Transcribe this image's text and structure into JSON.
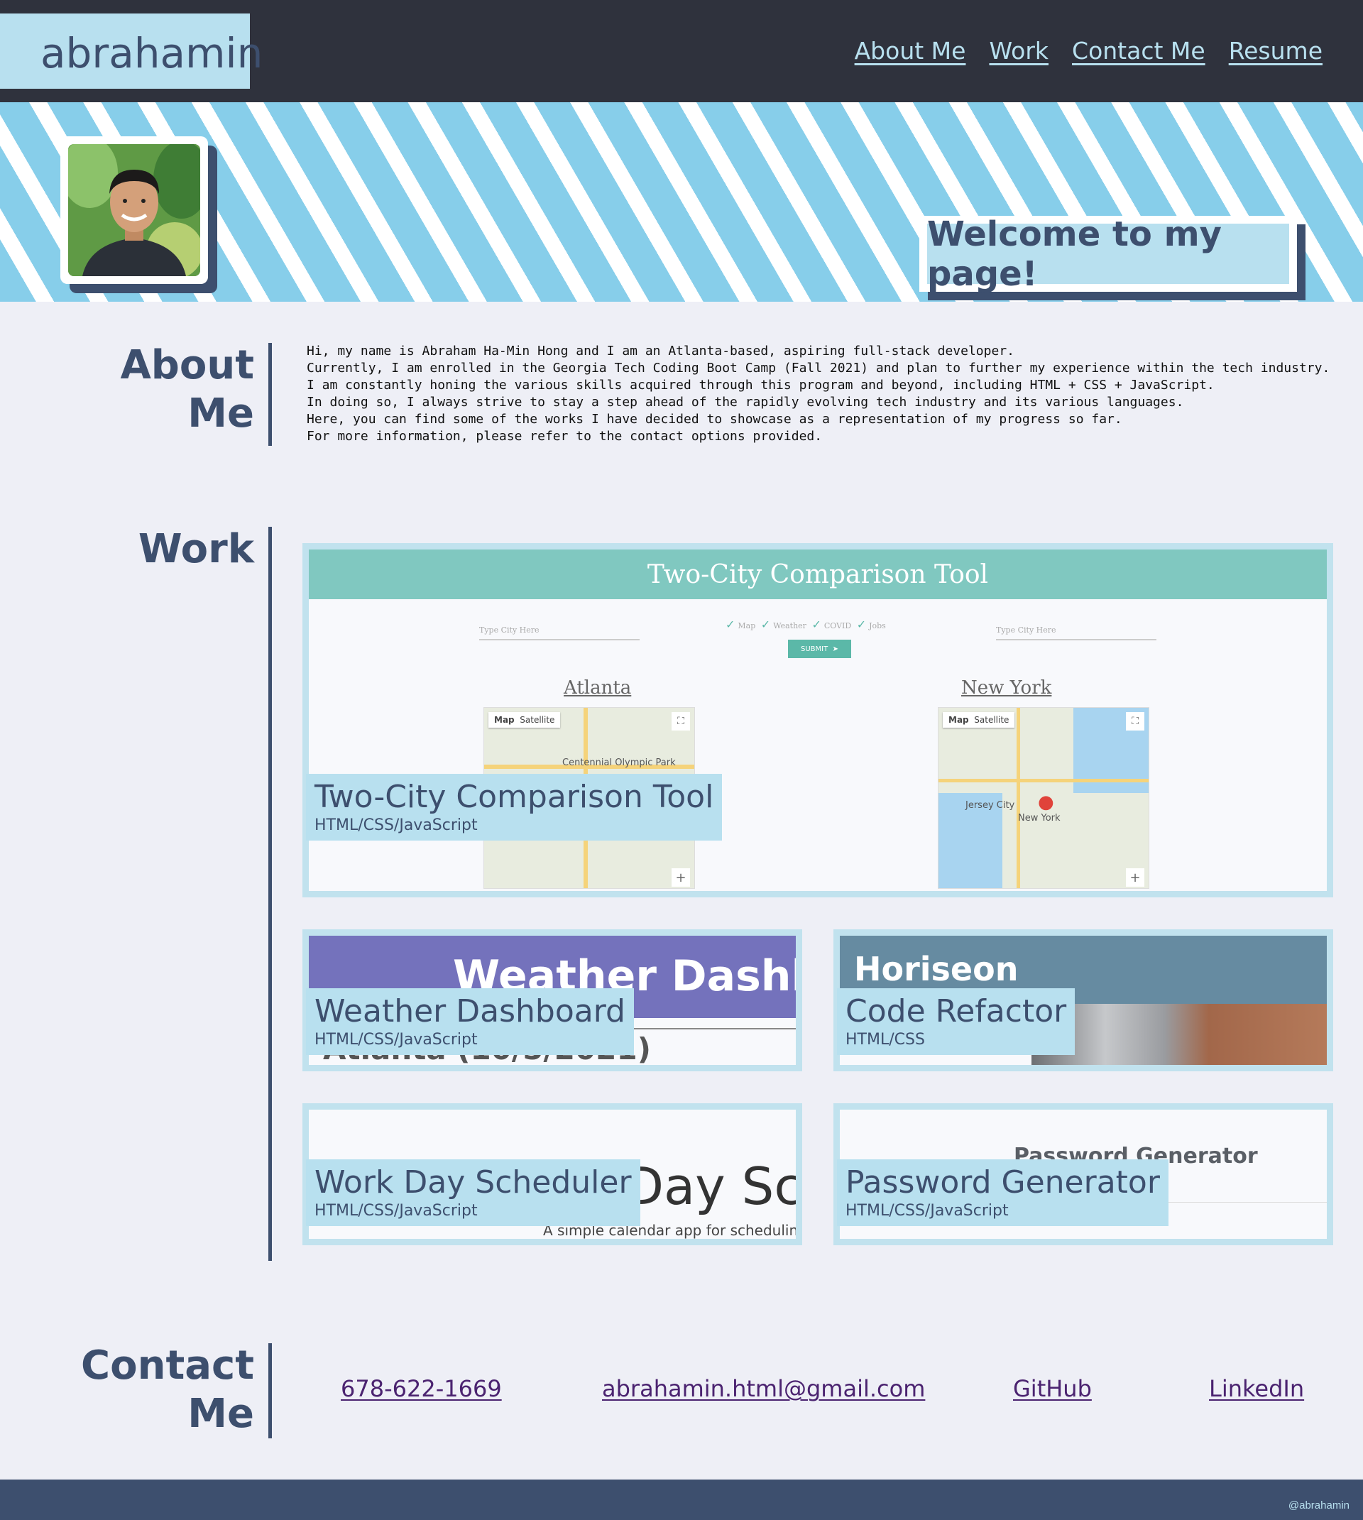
{
  "nav": {
    "logo": "abrahamin",
    "links": [
      "About Me",
      "Work",
      "Contact Me",
      "Resume"
    ]
  },
  "hero": {
    "welcome": "Welcome to my page!"
  },
  "about": {
    "title_line1": "About",
    "title_line2": "Me",
    "paragraphs": [
      "Hi, my name is Abraham Ha-Min Hong and I am an Atlanta-based, aspiring full-stack developer.",
      "Currently, I am enrolled in the Georgia Tech Coding Boot Camp (Fall 2021) and plan to further my experience within the tech industry.",
      "I am constantly honing the various skills acquired through this program and beyond, including HTML + CSS + JavaScript.",
      "In doing so, I always strive to stay a step ahead of the rapidly evolving tech industry and its various languages.",
      "Here, you can find some of the works I have decided to showcase as a representation of my progress so far.",
      "For more information, please refer to the contact options provided."
    ]
  },
  "work": {
    "title": "Work",
    "projects": [
      {
        "title": "Two-City Comparison Tool",
        "tech": "HTML/CSS/JavaScript"
      },
      {
        "title": "Weather Dashboard",
        "tech": "HTML/CSS/JavaScript"
      },
      {
        "title": "Code Refactor",
        "tech": "HTML/CSS"
      },
      {
        "title": "Work Day Scheduler",
        "tech": "HTML/CSS/JavaScript"
      },
      {
        "title": "Password Generator",
        "tech": "HTML/CSS/JavaScript"
      }
    ],
    "previews": {
      "two_city": {
        "header": "Two-City Comparison Tool",
        "input_placeholder": "Type City Here",
        "checks": [
          "Map",
          "Weather",
          "COVID",
          "Jobs"
        ],
        "submit": "SUBMIT",
        "city_left": "Atlanta",
        "city_right": "New York",
        "map_btn": "Map",
        "satellite_btn": "Satellite",
        "map_label_left": "Centennial Olympic Park",
        "map_label_right": "New York",
        "map_label_jersey": "Jersey City"
      },
      "weather": {
        "header": "Weather Dashboard",
        "city": "Atlanta (10/5/2021)"
      },
      "horiseon": {
        "header": "Horiseon"
      },
      "scheduler": {
        "big": "Work Day Scheduler",
        "visible_big": "k Day Sch",
        "sub": "A simple calendar app for scheduling y"
      },
      "password": {
        "header": "Password Generator"
      }
    }
  },
  "contact": {
    "title_line1": "Contact",
    "title_line2": "Me",
    "phone": "678-622-1669",
    "email": "abrahamin.html@gmail.com",
    "github": "GitHub",
    "linkedin": "LinkedIn"
  },
  "footer": {
    "handle": "@abrahamin"
  }
}
